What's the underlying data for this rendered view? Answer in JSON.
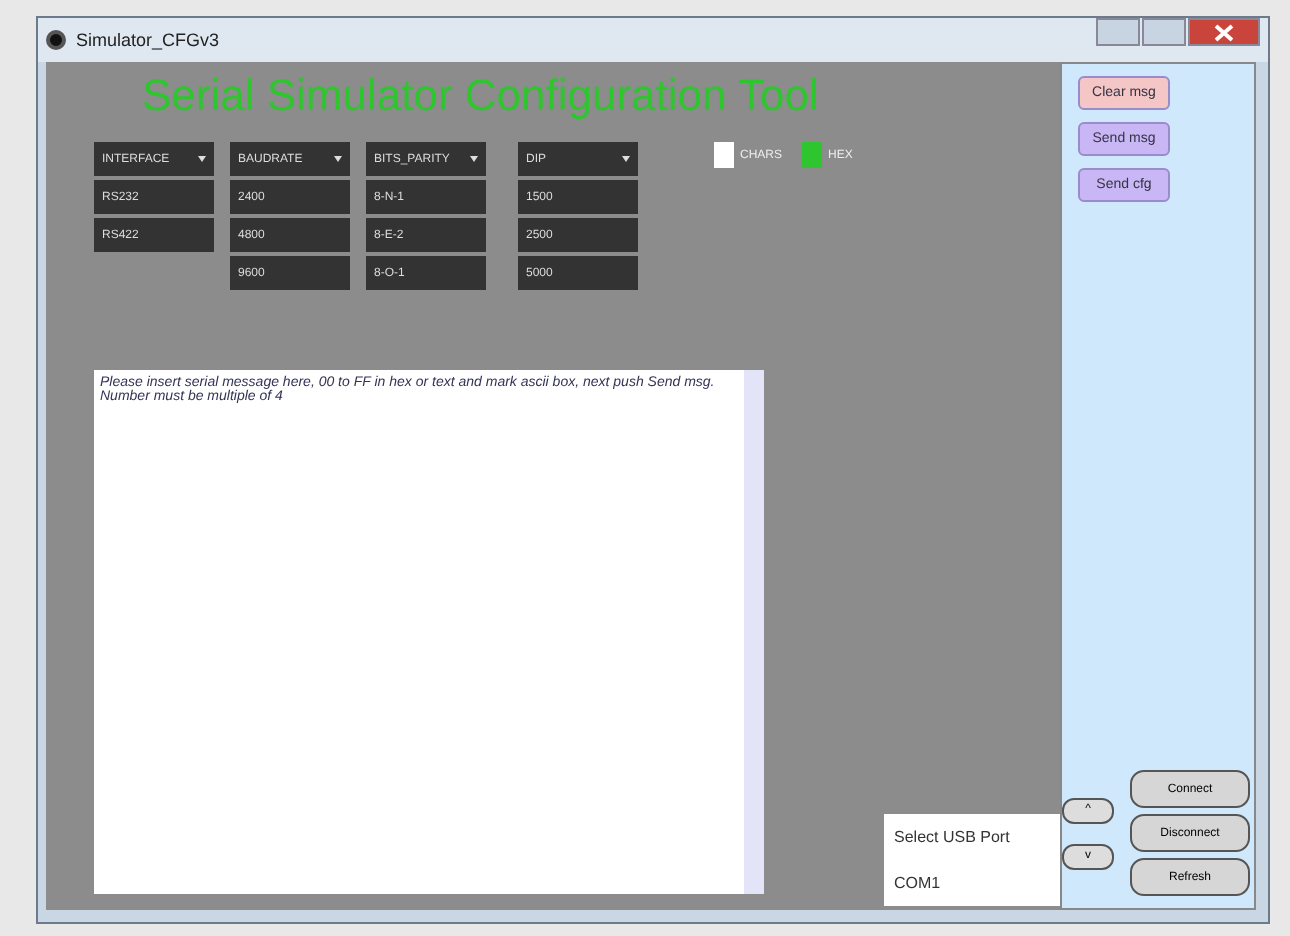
{
  "window": {
    "title": "Simulator_CFGv3"
  },
  "heading": "Serial Simulator Configuration Tool",
  "dropdowns": [
    {
      "label": "INTERFACE",
      "options": [
        "RS232",
        "RS422"
      ]
    },
    {
      "label": "BAUDRATE",
      "options": [
        "2400",
        "4800",
        "9600"
      ]
    },
    {
      "label": "BITS_PARITY",
      "options": [
        "8-N-1",
        "8-E-2",
        "8-O-1"
      ]
    },
    {
      "label": "DIP",
      "options": [
        "1500",
        "2500",
        "5000"
      ]
    }
  ],
  "checkboxes": [
    {
      "label": "CHARS",
      "checked": false
    },
    {
      "label": "HEX",
      "checked": true
    }
  ],
  "message": {
    "placeholder": "Please insert serial message here, 00 to FF in hex or text and mark ascii box, next push Send msg. Number must be multiple of 4"
  },
  "side_buttons": [
    {
      "label": "Clear msg",
      "color": "#f4c6c6"
    },
    {
      "label": "Send msg",
      "color": "#c9b6f4"
    },
    {
      "label": "Send cfg",
      "color": "#c9b6f4"
    }
  ],
  "usb": {
    "label": "Select USB Port",
    "port": "COM1"
  },
  "arrows": [
    "^",
    "v"
  ],
  "connection_buttons": [
    "Connect",
    "Disconnect",
    "Refresh"
  ]
}
